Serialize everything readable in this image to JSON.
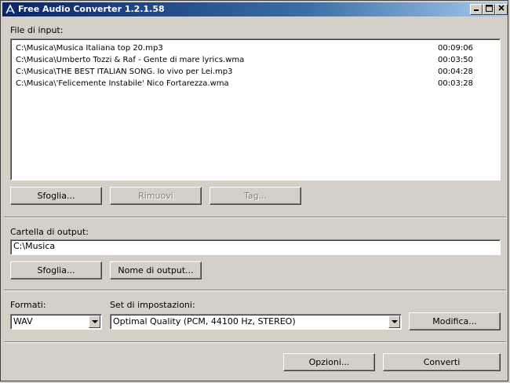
{
  "window": {
    "title": "Free Audio Converter 1.2.1.58"
  },
  "input": {
    "label": "File di input:",
    "files": [
      {
        "path": "C:\\Musica\\Musica Italiana top 20.mp3",
        "duration": "00:09:06"
      },
      {
        "path": "C:\\Musica\\Umberto Tozzi & Raf - Gente di mare lyrics.wma",
        "duration": "00:03:50"
      },
      {
        "path": "C:\\Musica\\THE BEST ITALIAN SONG. Io vivo per Lei.mp3",
        "duration": "00:04:28"
      },
      {
        "path": "C:\\Musica\\'Felicemente Instabile'  Nico Fortarezza.wma",
        "duration": "00:03:28"
      }
    ],
    "browse_label": "Sfoglia...",
    "remove_label": "Rimuovi",
    "tag_label": "Tag..."
  },
  "output": {
    "label": "Cartella di output:",
    "folder": "C:\\Musica",
    "browse_label": "Sfoglia...",
    "output_name_label": "Nome di output..."
  },
  "formats": {
    "label": "Formati:",
    "selected": "WAV"
  },
  "settings": {
    "label": "Set di impostazioni:",
    "selected": "Optimal Quality (PCM, 44100 Hz, STEREO)",
    "modify_label": "Modifica..."
  },
  "footer": {
    "options_label": "Opzioni...",
    "convert_label": "Converti"
  }
}
